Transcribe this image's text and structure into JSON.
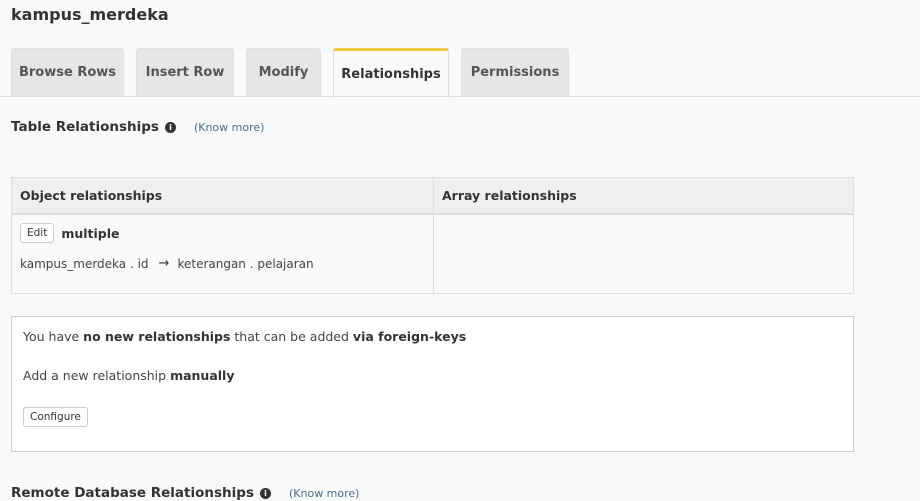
{
  "page_title": "kampus_merdeka",
  "tabs": [
    {
      "label": "Browse Rows"
    },
    {
      "label": "Insert Row"
    },
    {
      "label": "Modify"
    },
    {
      "label": "Relationships"
    },
    {
      "label": "Permissions"
    }
  ],
  "active_tab": "Relationships",
  "table_relationships": {
    "heading": "Table Relationships",
    "know_more": "(Know more)",
    "columns": {
      "object": "Object relationships",
      "array": "Array relationships"
    },
    "object_relationships": [
      {
        "edit_label": "Edit",
        "name": "multiple",
        "from": "kampus_merdeka . id",
        "arrow": "→",
        "to": "keterangan . pelajaran"
      }
    ]
  },
  "foreign_keys": {
    "line1_a": "You have ",
    "line1_b": "no new relationships",
    "line1_c": " that can be added ",
    "line1_d": "via foreign-keys",
    "line2_a": "Add a new relationship ",
    "line2_b": "manually",
    "configure_label": "Configure"
  },
  "remote_db": {
    "heading": "Remote Database Relationships",
    "know_more": "(Know more)"
  }
}
